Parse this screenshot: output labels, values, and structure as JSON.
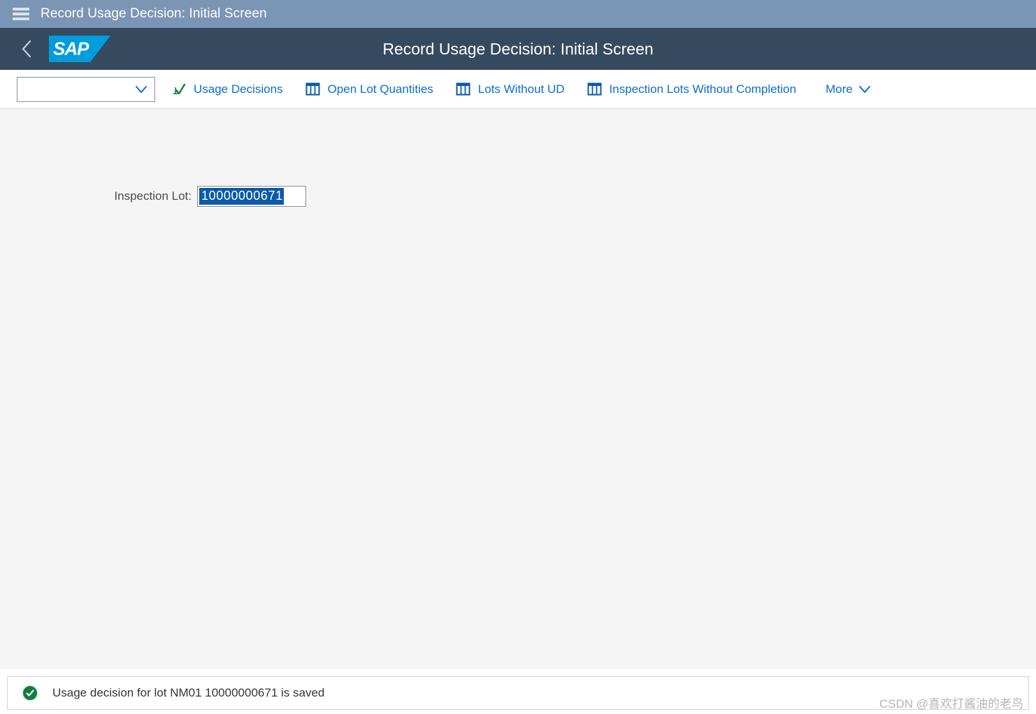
{
  "window": {
    "title": "Record Usage Decision: Initial Screen",
    "menu_icon": "hamburger-icon"
  },
  "shell": {
    "back_icon": "chevron-left-icon",
    "logo_text": "SAP",
    "page_title": "Record Usage Decision: Initial Screen"
  },
  "toolbar": {
    "view_select": {
      "value": "",
      "placeholder": "",
      "icon": "chevron-down-icon"
    },
    "items": [
      {
        "label": "Usage Decisions",
        "icon": "usage-decision-check-icon"
      },
      {
        "label": "Open Lot Quantities",
        "icon": "table-grid-icon"
      },
      {
        "label": "Lots Without UD",
        "icon": "table-grid-icon"
      },
      {
        "label": "Inspection Lots Without Completion",
        "icon": "table-grid-icon"
      }
    ],
    "more_label": "More",
    "more_icon": "chevron-down-icon"
  },
  "form": {
    "inspection_lot_label": "Inspection Lot:",
    "inspection_lot_value": "10000000671"
  },
  "message": {
    "icon": "success-check-circle-icon",
    "text": "Usage decision for lot NM01 10000000671 is saved",
    "type": "success"
  },
  "watermark": {
    "text": "CSDN @喜欢打酱油的老鸟"
  },
  "colors": {
    "shell_title_bar": "#7b95b4",
    "sap_shell_bar": "#354a5f",
    "sap_logo": "#009ddc",
    "link_blue": "#0a6ed1",
    "content_bg": "#f5f5f5",
    "selection_blue": "#0a5aa8",
    "success_green": "#107e3e"
  }
}
